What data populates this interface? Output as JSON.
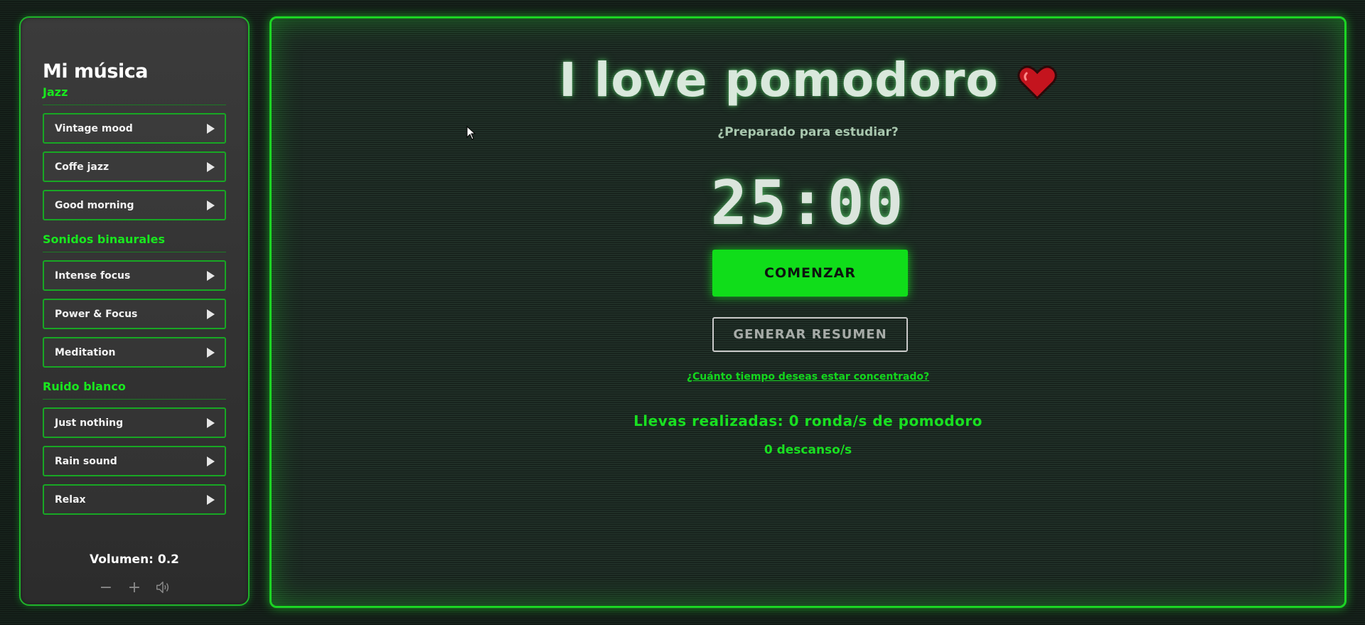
{
  "sidebar": {
    "title": "Mi música",
    "sections": [
      {
        "name": "Jazz",
        "tracks": [
          "Vintage mood",
          "Coffe jazz",
          "Good morning"
        ]
      },
      {
        "name": "Sonidos binaurales",
        "tracks": [
          "Intense focus",
          "Power & Focus",
          "Meditation"
        ]
      },
      {
        "name": "Ruido blanco",
        "tracks": [
          "Just nothing",
          "Rain sound",
          "Relax"
        ]
      }
    ],
    "volume_label": "Volumen: 0.2",
    "volume_controls": [
      {
        "icon": "minus-icon",
        "glyph": "−"
      },
      {
        "icon": "plus-icon",
        "glyph": "+"
      },
      {
        "icon": "speaker-icon",
        "glyph": "🔊"
      }
    ]
  },
  "main": {
    "title": "I love pomodoro",
    "title_icon": "heart-icon",
    "subtitle": "¿Preparado para estudiar?",
    "timer": "25:00",
    "start_button": "COMENZAR",
    "summary_button": "GENERAR RESUMEN",
    "time_link": "¿Cuánto tiempo deseas estar concentrado?",
    "rounds_text": "Llevas realizadas: 0 ronda/s de pomodoro",
    "breaks_text": "0 descanso/s"
  },
  "colors": {
    "accent": "#10dd1a",
    "background": "#16211b",
    "sidebar_bg": "#353535",
    "heart": "#c4141e"
  }
}
